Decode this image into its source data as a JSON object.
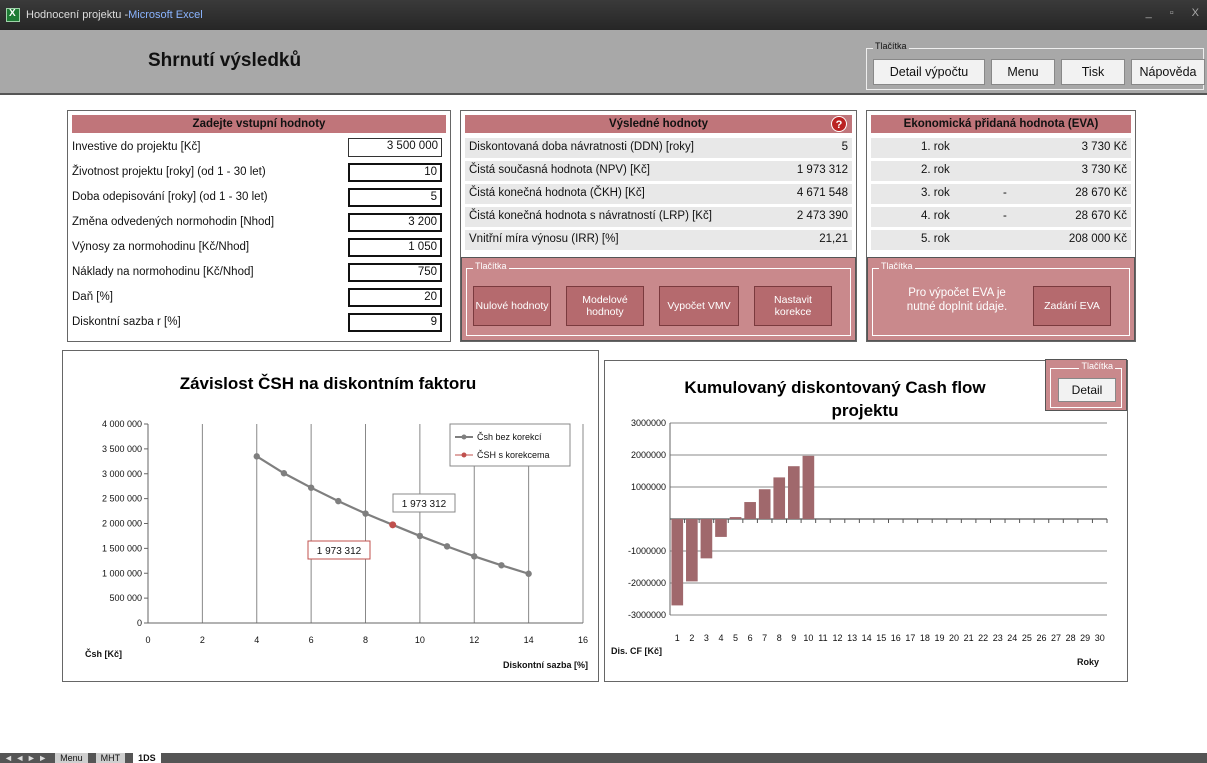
{
  "window": {
    "doc": "Hodnocení projektu - ",
    "app": "Microsoft Excel",
    "controls": [
      "_",
      "▫",
      "X"
    ]
  },
  "header": {
    "title": "Shrnutí výsledků",
    "group_label": "Tlačítka",
    "buttons": [
      "Detail výpočtu",
      "Menu",
      "Tisk",
      "Nápověda"
    ]
  },
  "inputs": {
    "heading": "Zadejte vstupní hodnoty",
    "rows": [
      {
        "label": "Investive do projektu [Kč]",
        "value": "3 500 000"
      },
      {
        "label": "Životnost projektu [roky] (od 1 - 30 let)",
        "value": "10"
      },
      {
        "label": "Doba odepisování [roky] (od 1 - 30 let)",
        "value": "5"
      },
      {
        "label": "Změna odvedených normohodin [Nhod]",
        "value": "3 200"
      },
      {
        "label": "Výnosy za normohodinu [Kč/Nhod]",
        "value": "1 050"
      },
      {
        "label": "Náklady na normohodinu [Kč/Nhod]",
        "value": "750"
      },
      {
        "label": "Daň  [%]",
        "value": "20"
      },
      {
        "label": "Diskontní sazba r [%]",
        "value": "9"
      }
    ]
  },
  "results": {
    "heading": "Výsledné hodnoty",
    "help_icon": "?",
    "rows": [
      {
        "label": "Diskontovaná doba návratnosti (DDN) [roky]",
        "value": "5"
      },
      {
        "label": "Čistá současná hodnota (NPV) [Kč]",
        "value": "1 973 312"
      },
      {
        "label": "Čistá konečná hodnota (ČKH) [Kč]",
        "value": "4 671 548"
      },
      {
        "label": "Čistá konečná hodnota s návratností (LRP) [Kč]",
        "value": "2 473 390"
      },
      {
        "label": "Vnitřní míra výnosu (IRR) [%]",
        "value": "21,21"
      }
    ],
    "group_label": "Tlačítka",
    "buttons": [
      "Nulové hodnoty",
      "Modelové hodnoty",
      "Vypočet VMV",
      "Nastavit korekce"
    ]
  },
  "eva": {
    "heading": "Ekonomická přidaná hodnota (EVA)",
    "rows": [
      {
        "year": "1. rok",
        "sign": "",
        "value": "3 730 Kč"
      },
      {
        "year": "2. rok",
        "sign": "",
        "value": "3 730 Kč"
      },
      {
        "year": "3. rok",
        "sign": "-",
        "value": "28 670 Kč"
      },
      {
        "year": "4. rok",
        "sign": "-",
        "value": "28 670 Kč"
      },
      {
        "year": "5. rok",
        "sign": "",
        "value": "208 000 Kč"
      }
    ],
    "group_label": "Tlačítka",
    "note": "Pro výpočet EVA je nutné doplnit údaje.",
    "button": "Zadání EVA"
  },
  "chart_data": [
    {
      "type": "line",
      "title": "Závislost ČSH na diskontním faktoru",
      "xlabel": "Diskontní sazba [%]",
      "ylabel": "Čsh [Kč]",
      "xlim": [
        0,
        16
      ],
      "ylim": [
        0,
        4000000
      ],
      "x_ticks": [
        "0",
        "2",
        "4",
        "6",
        "8",
        "10",
        "12",
        "14",
        "16"
      ],
      "y_ticks": [
        "0",
        "500 000",
        "1 000 000",
        "1 500 000",
        "2 000 000",
        "2 500 000",
        "3 000 000",
        "3 500 000",
        "4 000 000"
      ],
      "series": [
        {
          "name": "Čsh bez korekcí",
          "color": "#7f7f7f",
          "x": [
            4,
            5,
            6,
            7,
            8,
            9,
            10,
            11,
            12,
            13,
            14
          ],
          "y": [
            3350000,
            3010000,
            2720000,
            2450000,
            2200000,
            1973312,
            1750000,
            1540000,
            1340000,
            1160000,
            990000
          ]
        },
        {
          "name": "ČSH s korekcema",
          "color": "#c0504d",
          "x": [
            9
          ],
          "y": [
            1973312
          ]
        }
      ],
      "annotations": [
        "1 973 312",
        "1 973 312"
      ],
      "legend": "top-right",
      "grid": "vertical"
    },
    {
      "type": "bar",
      "title": "Kumulovaný diskontovaný Cash flow projektu",
      "xlabel": "Roky",
      "ylabel": "Dis. CF [Kč]",
      "ylim": [
        -3000000,
        3000000
      ],
      "y_ticks": [
        "3000000",
        "2000000",
        "1000000",
        "",
        "-1000000",
        "-2000000",
        "-3000000"
      ],
      "categories": [
        "1",
        "2",
        "3",
        "4",
        "5",
        "6",
        "7",
        "8",
        "9",
        "10",
        "11",
        "12",
        "13",
        "14",
        "15",
        "16",
        "17",
        "18",
        "19",
        "20",
        "21",
        "22",
        "23",
        "24",
        "25",
        "26",
        "27",
        "28",
        "29",
        "30"
      ],
      "values": [
        -2700000,
        -1950000,
        -1230000,
        -560000,
        60000,
        530000,
        930000,
        1300000,
        1650000,
        1973312,
        0,
        0,
        0,
        0,
        0,
        0,
        0,
        0,
        0,
        0,
        0,
        0,
        0,
        0,
        0,
        0,
        0,
        0,
        0,
        0
      ],
      "color": "#a0686c",
      "grid": "horizontal"
    }
  ],
  "chart2_group": {
    "label": "Tlačítka",
    "button": "Detail"
  },
  "sheets": {
    "nav": "◄ ◄ ► ►",
    "tabs": [
      "Menu",
      "MHT",
      "1DS"
    ]
  }
}
